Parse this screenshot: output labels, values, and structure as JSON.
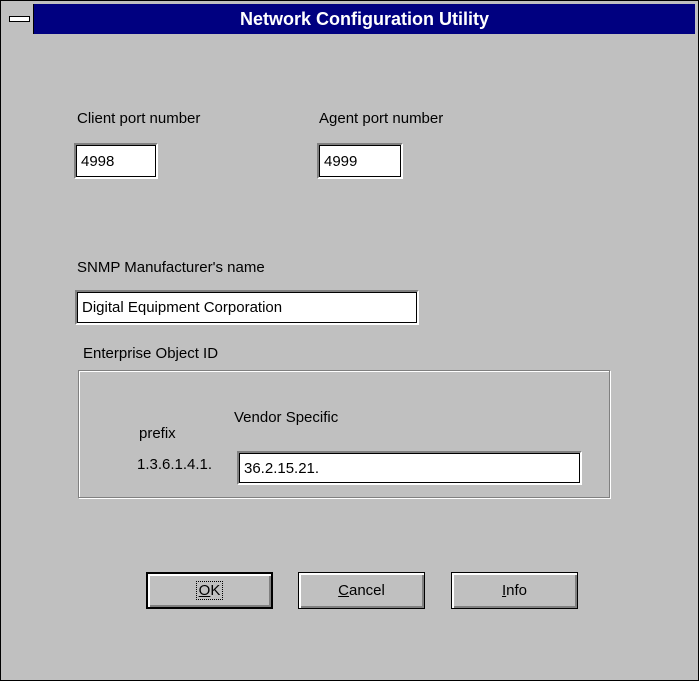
{
  "window": {
    "title": "Network Configuration Utility"
  },
  "client_port": {
    "label": "Client port number",
    "value": "4998"
  },
  "agent_port": {
    "label": "Agent port number",
    "value": "4999"
  },
  "snmp": {
    "label": "SNMP Manufacturer's name",
    "value": "Digital Equipment Corporation"
  },
  "enterprise": {
    "group_label": "Enterprise Object ID",
    "prefix_label": "prefix",
    "vendor_label": "Vendor Specific",
    "prefix_value": "1.3.6.1.4.1.",
    "vendor_value": "36.2.15.21."
  },
  "buttons": {
    "ok_mnemonic": "O",
    "ok_rest": "K",
    "cancel_mnemonic": "C",
    "cancel_rest": "ancel",
    "info_mnemonic": "I",
    "info_rest": "nfo"
  }
}
